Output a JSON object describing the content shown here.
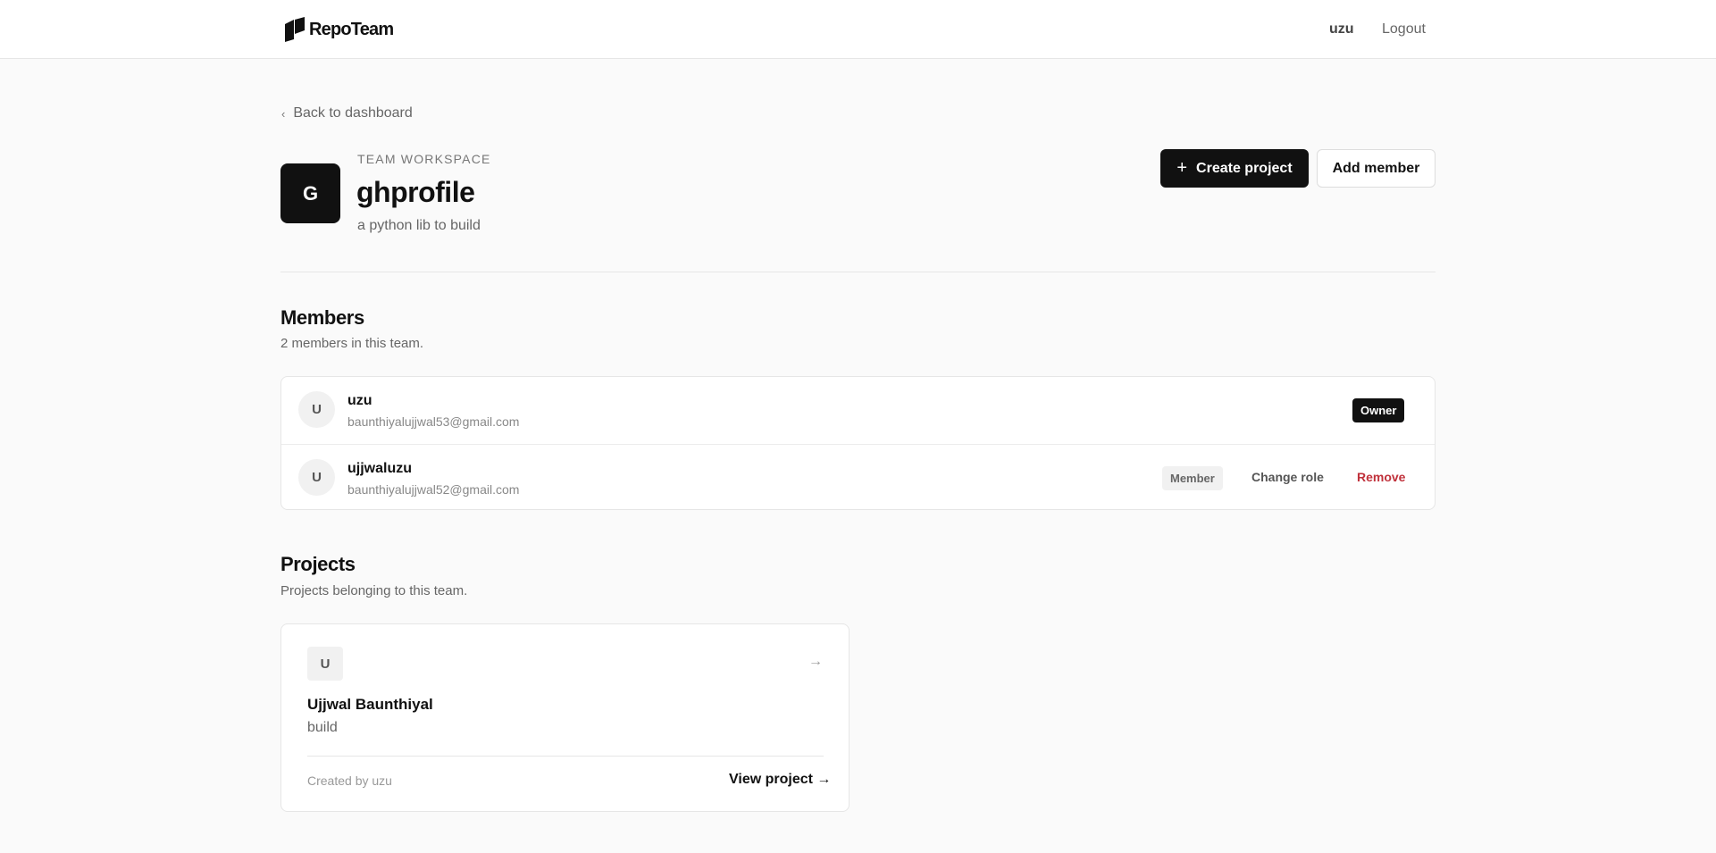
{
  "app": {
    "brand": "RepoTeam"
  },
  "nav": {
    "user": "uzu",
    "logout": "Logout"
  },
  "back_link": "Back to dashboard",
  "team": {
    "avatar_letter": "G",
    "eyebrow": "TEAM WORKSPACE",
    "name": "ghprofile",
    "description": "a python lib to build"
  },
  "actions": {
    "create_project": "Create project",
    "add_member": "Add member"
  },
  "members": {
    "title": "Members",
    "subtitle": "2 members in this team.",
    "list": [
      {
        "initial": "U",
        "name": "uzu",
        "email": "baunthiyalujjwal53@gmail.com",
        "role": "Owner"
      },
      {
        "initial": "U",
        "name": "ujjwaluzu",
        "email": "baunthiyalujjwal52@gmail.com",
        "role": "Member",
        "change_role": "Change role",
        "remove": "Remove"
      }
    ]
  },
  "projects": {
    "title": "Projects",
    "subtitle": "Projects belonging to this team.",
    "list": [
      {
        "initial": "U",
        "name": "Ujjwal Baunthiyal",
        "description": "build",
        "created_by": "Created by uzu",
        "view": "View project →",
        "arrow": "→"
      }
    ]
  },
  "colors": {
    "primary": "#111111",
    "background": "#fafafa",
    "danger": "#c0313b"
  }
}
